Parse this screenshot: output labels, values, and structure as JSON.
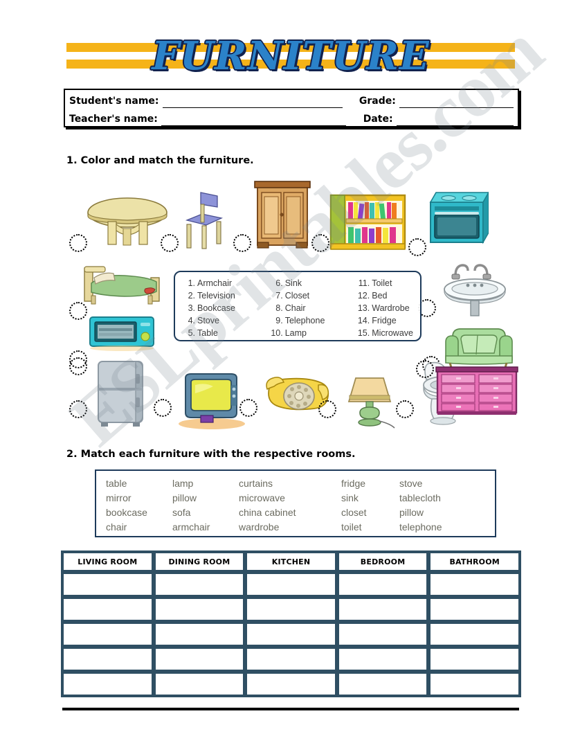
{
  "title": "FURNITURE",
  "header_fields": {
    "student_label": "Student's name:",
    "teacher_label": "Teacher's name:",
    "grade_label": "Grade:",
    "date_label": "Date:"
  },
  "watermark": "ESLprintables.com",
  "exercise1": {
    "heading": "1. Color and match the furniture.",
    "word_list_columns": [
      [
        {
          "num": "1.",
          "word": "Armchair"
        },
        {
          "num": "2.",
          "word": "Television"
        },
        {
          "num": "3.",
          "word": "Bookcase"
        },
        {
          "num": "4.",
          "word": "Stove"
        },
        {
          "num": "5.",
          "word": "Table"
        }
      ],
      [
        {
          "num": "6.",
          "word": "Sink"
        },
        {
          "num": "7.",
          "word": "Closet"
        },
        {
          "num": "8.",
          "word": "Chair"
        },
        {
          "num": "9.",
          "word": "Telephone"
        },
        {
          "num": "10.",
          "word": "Lamp"
        }
      ],
      [
        {
          "num": "11.",
          "word": "Toilet"
        },
        {
          "num": "12.",
          "word": "Bed"
        },
        {
          "num": "13.",
          "word": "Wardrobe"
        },
        {
          "num": "14.",
          "word": "Fridge"
        },
        {
          "num": "15.",
          "word": "Microwave"
        }
      ]
    ],
    "pictures": [
      {
        "name": "round-table",
        "label": "round wooden table"
      },
      {
        "name": "chair",
        "label": "blue chair"
      },
      {
        "name": "wardrobe",
        "label": "wooden wardrobe"
      },
      {
        "name": "bookcase",
        "label": "yellow bookcase with books"
      },
      {
        "name": "stove",
        "label": "teal stove"
      },
      {
        "name": "bed",
        "label": "bed with green blanket"
      },
      {
        "name": "microwave",
        "label": "teal microwave"
      },
      {
        "name": "sink",
        "label": "bathroom sink with taps"
      },
      {
        "name": "armchair",
        "label": "green armchair"
      },
      {
        "name": "fridge",
        "label": "grey fridge"
      },
      {
        "name": "television",
        "label": "retro television"
      },
      {
        "name": "telephone",
        "label": "yellow rotary telephone"
      },
      {
        "name": "lamp",
        "label": "table lamp"
      },
      {
        "name": "toilet",
        "label": "toilet"
      },
      {
        "name": "dresser",
        "label": "pink dresser"
      }
    ]
  },
  "exercise2": {
    "heading": "2. Match each furniture with the respective rooms.",
    "word_bank_columns": [
      [
        "table",
        "mirror",
        "bookcase",
        "chair"
      ],
      [
        "lamp",
        "pillow",
        "sofa",
        "armchair"
      ],
      [
        "curtains",
        "microwave",
        "china cabinet",
        "wardrobe"
      ],
      [
        "fridge",
        "sink",
        "closet",
        "toilet"
      ],
      [
        "stove",
        "tablecloth",
        "pillow",
        "telephone"
      ]
    ],
    "table_headers": [
      "LIVING ROOM",
      "DINING ROOM",
      "KITCHEN",
      "BEDROOM",
      "BATHROOM"
    ],
    "table_empty_rows": 5
  },
  "colors": {
    "banner_band": "#f5b319",
    "title_fill": "#2b82c9",
    "title_outline": "#11224f",
    "table_border": "#2f4f63",
    "box_border": "#1d3a5a",
    "word_text": "#6b6b60"
  }
}
